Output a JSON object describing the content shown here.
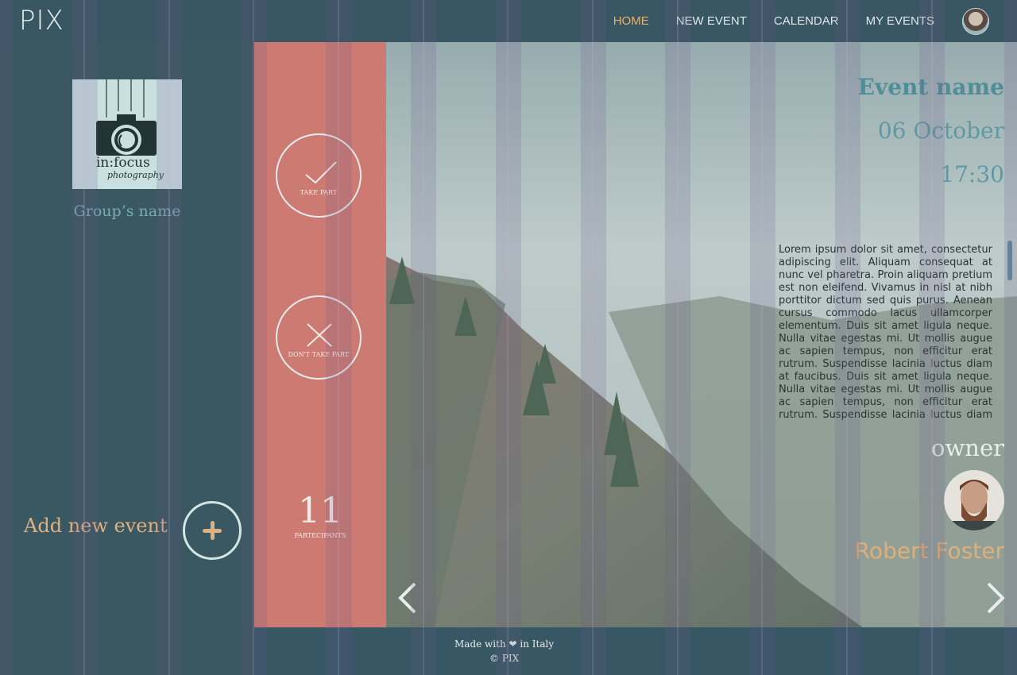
{
  "app": {
    "logo": "PIX"
  },
  "nav": {
    "items": [
      {
        "label": "HOME",
        "active": true
      },
      {
        "label": "NEW EVENT",
        "active": false
      },
      {
        "label": "CALENDAR",
        "active": false
      },
      {
        "label": "MY EVENTS",
        "active": false
      }
    ]
  },
  "sidebar": {
    "group_name": "Group’s name",
    "add_event_label": "Add new event",
    "group_logo": {
      "line1": "in:focus",
      "line2": "photography"
    }
  },
  "actions": {
    "take_part": "TAKE PART",
    "dont_take_part": "DON'T TAKE PART",
    "participants_count": "11",
    "participants_label": "PARTECIPANTS"
  },
  "event": {
    "name": "Event name",
    "date": "06 October",
    "time": "17:30",
    "description": "Lorem ipsum dolor sit amet, consectetur adipiscing elit. Aliquam consequat at nunc vel pharetra. Proin aliquam pretium est non eleifend. Vivamus in nisl at nibh porttitor dictum sed quis purus. Aenean cursus commodo lacus ullamcorper elementum. Duis sit amet ligula neque. Nulla vitae egestas mi. Ut mollis augue ac sapien tempus, non efficitur erat rutrum. Suspendisse lacinia luctus diam at faucibus. Duis sit amet ligula neque. Nulla vitae egestas mi. Ut mollis augue ac sapien tempus, non efficitur erat rutrum. Suspendisse lacinia luctus diam at",
    "owner_title": "owner",
    "owner_name": "Robert Foster"
  },
  "footer": {
    "made_prefix": "Made with",
    "made_suffix": "in Italy",
    "copyright": "© PIX"
  },
  "colors": {
    "accent": "#e8b070",
    "teal": "#3a5862",
    "coral": "#cc7a72"
  },
  "icons": [
    "avatar",
    "check-icon",
    "close-icon",
    "plus-icon",
    "heart-icon",
    "chevron-left-icon",
    "chevron-right-icon"
  ]
}
